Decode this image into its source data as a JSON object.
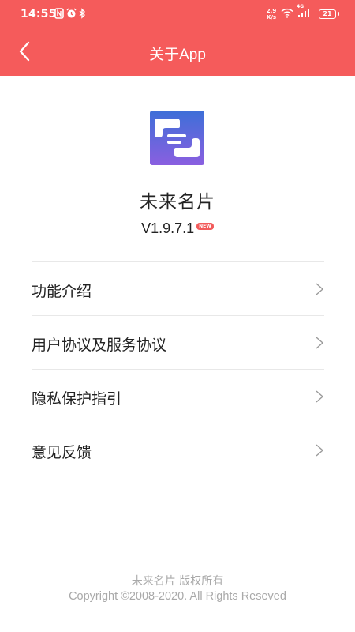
{
  "status_bar": {
    "time": "14:55",
    "net_speed_value": "2.9",
    "net_speed_unit": "K/s",
    "signal_label": "4G",
    "battery": "21",
    "icons": [
      "nfc-icon",
      "alarm-icon",
      "bluetooth-icon",
      "wifi-icon",
      "signal-icon",
      "battery-icon"
    ]
  },
  "header": {
    "title": "关于App",
    "back_icon": "chevron-left-icon"
  },
  "app": {
    "logo_icon": "app-logo-icon",
    "name": "未来名片",
    "version": "V1.9.7.1",
    "badge": "NEW"
  },
  "menu": {
    "items": [
      {
        "label": "功能介绍"
      },
      {
        "label": "用户协议及服务协议"
      },
      {
        "label": "隐私保护指引"
      },
      {
        "label": "意见反馈"
      }
    ]
  },
  "footer": {
    "line1": "未来名片 版权所有",
    "line2": "Copyright ©2008-2020. All Rights Reseved"
  },
  "colors": {
    "header_bg": "#f55b5b",
    "badge_bg": "#f25b5b",
    "logo_gradient_top": "#3d6fd8",
    "logo_gradient_bottom": "#8a5fe0",
    "footer_text": "#a9a9a9"
  }
}
